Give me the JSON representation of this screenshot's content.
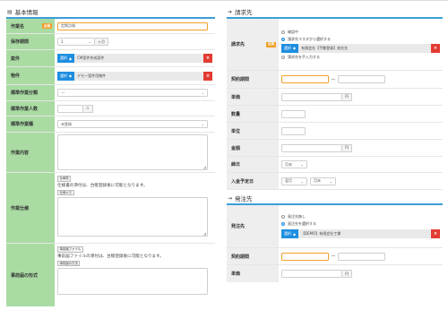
{
  "left": {
    "section_title": "基本情報",
    "required_label": "必須",
    "work_name": {
      "label": "作業名",
      "value": "定期点検"
    },
    "cycle": {
      "label": "保存期間",
      "value": "2",
      "unit": "ヶ月"
    },
    "case": {
      "label": "案件",
      "button": "選択",
      "value": "CM案件作成案件"
    },
    "property": {
      "label": "物件",
      "button": "選択",
      "value": "デモー案件用物件"
    },
    "category": {
      "label": "標準作業分類",
      "value": "---"
    },
    "people": {
      "label": "標準作業人数",
      "value": "",
      "unit": "人"
    },
    "work_type": {
      "label": "標準作業種",
      "value": "未登録"
    },
    "content": {
      "label": "作業内容",
      "value": ""
    },
    "spec": {
      "label": "作業仕様",
      "tag1": "仕様書",
      "note": "仕様書の添付は、台帳登録後に可能となります。",
      "tag2": "仕様メモ"
    },
    "pre_form": {
      "label": "事前届の形式",
      "tag1": "事前届ファイル",
      "note": "事前届ファイルの添付は、台帳登録後に可能となります。",
      "tag2": "事前届の方法"
    }
  },
  "right": {
    "billing_title": "請求先",
    "billing": {
      "label": "請求先",
      "required_label": "必須",
      "options": [
        "確認中",
        "請求先マスタから選択する",
        "請求先を手入力する"
      ],
      "button": "選択",
      "value": "有限会社【手動登録】宛先先"
    },
    "billing_period": {
      "label": "契約期間",
      "separator": "〜"
    },
    "unit_price": {
      "label": "単価",
      "unit": "円"
    },
    "quantity": {
      "label": "数量"
    },
    "unit": {
      "label": "単位"
    },
    "amount": {
      "label": "金額",
      "unit": "円"
    },
    "cutoff": {
      "label": "締日",
      "value": "月末"
    },
    "deposit": {
      "label": "入金予定日",
      "month": "翌月",
      "day": "月末"
    },
    "order_title": "発注先",
    "order": {
      "label": "発注先",
      "options": [
        "発注先無し",
        "発注先を選択する"
      ],
      "button": "選択",
      "value": "【DEMO】有限会社丁課"
    },
    "order_period": {
      "label": "契約期間",
      "separator": "〜"
    },
    "order_price": {
      "label": "単価",
      "unit": "円"
    }
  }
}
